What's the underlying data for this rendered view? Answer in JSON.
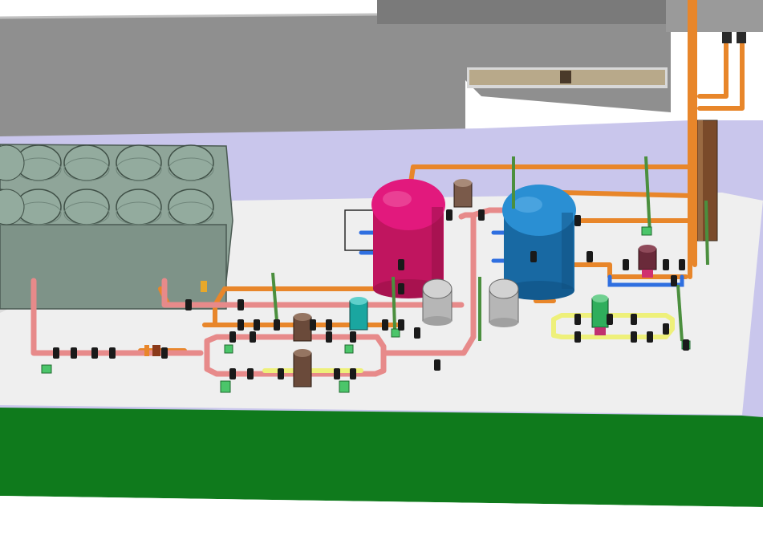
{
  "scene": {
    "kind": "3D CAD render of a mechanical plant room layout",
    "colors": {
      "background": "#ffffff",
      "roof_gray": "#8f8f8f",
      "roof_dark": "#6e6e6e",
      "floor_lavender": "#c9c6ec",
      "skid_slab": "#efefef",
      "grass": "#0f7a1c",
      "chiller_body": "#8fa599",
      "chiller_fan": "#93ab9e",
      "tank_magenta": "#e2197d",
      "tank_blue": "#1f7fc1",
      "expansion_tank": "#c8c8c8",
      "pipe_orange": "#e8862a",
      "pipe_pink": "#e78a8a",
      "pipe_yellow": "#eef07a",
      "pipe_blue": "#2f6fe0",
      "valve_black": "#1a1a1a",
      "support_green": "#4b8f3e",
      "pump_brown": "#7a5a4a",
      "pump_teal": "#1aa6a0",
      "pump_green": "#2fae5c",
      "column_brown": "#8a5a3a"
    },
    "components": {
      "chiller": {
        "fan_count": 12
      },
      "buffer_tanks": [
        "hot-buffer-tank",
        "chilled-buffer-tank"
      ],
      "expansion_vessels": 2,
      "pumps": 6
    }
  }
}
